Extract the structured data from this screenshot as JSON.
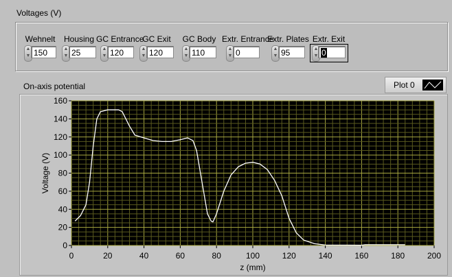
{
  "voltages": {
    "title": "Voltages (V)",
    "controls": [
      {
        "label": "Wehnelt",
        "value": "150"
      },
      {
        "label": "Housing",
        "value": "25"
      },
      {
        "label": "GC Entrance",
        "value": "120"
      },
      {
        "label": "GC Exit",
        "value": "120"
      },
      {
        "label": "GC Body",
        "value": "110"
      },
      {
        "label": "Extr. Entrance",
        "value": "0"
      },
      {
        "label": "Extr. Plates",
        "value": "95"
      },
      {
        "label": "Extr. Exit",
        "value": "0"
      }
    ]
  },
  "graph": {
    "title": "On-axis potential",
    "legend": "Plot 0"
  },
  "chart_data": {
    "type": "line",
    "title": "On-axis potential",
    "xlabel": "z (mm)",
    "ylabel": "Voltage (V)",
    "xlim": [
      0,
      200
    ],
    "ylim": [
      0,
      160
    ],
    "grid": true,
    "xticks": [
      0,
      20,
      40,
      60,
      80,
      100,
      120,
      140,
      160,
      180,
      200
    ],
    "yticks": [
      0,
      20,
      40,
      60,
      80,
      100,
      120,
      140,
      160
    ],
    "series": [
      {
        "name": "Plot 0",
        "color": "#ffffff",
        "x": [
          2,
          5,
          8,
          10,
          12,
          14,
          16,
          20,
          26,
          28,
          32,
          35,
          40,
          45,
          50,
          55,
          60,
          64,
          67,
          69,
          72,
          75,
          77,
          78,
          80,
          84,
          88,
          92,
          96,
          100,
          104,
          108,
          112,
          116,
          120,
          124,
          128,
          134,
          140,
          160,
          162,
          184
        ],
        "y": [
          27,
          33,
          45,
          70,
          110,
          140,
          148,
          150,
          150,
          148,
          132,
          122,
          119,
          116,
          115,
          115,
          117,
          119,
          116,
          105,
          70,
          35,
          27,
          26,
          35,
          60,
          78,
          87,
          91,
          92,
          90,
          84,
          72,
          55,
          30,
          14,
          6,
          2,
          0.5,
          0.3,
          0.8,
          0.8
        ]
      }
    ]
  }
}
